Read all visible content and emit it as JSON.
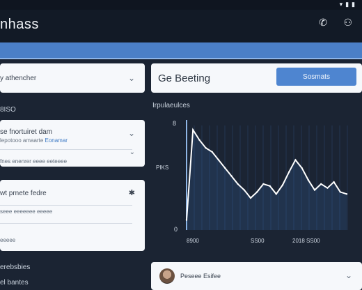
{
  "status_bar": {
    "icons": [
      "wifi-icon",
      "signal-icon",
      "battery-icon"
    ]
  },
  "app_bar": {
    "title": "nhass",
    "icons": [
      "phone-icon",
      "profile-icon"
    ]
  },
  "left_panel": {
    "dropdown_1": {
      "value": "y athencher"
    },
    "section_1_label": "8ISO",
    "card_2": {
      "header": "se fnortuiret dam",
      "subtext": "lepotooo amaarte",
      "subtext_link": "Eonamar",
      "row": "fnes enenrer eeee eeteeee"
    },
    "card_3": {
      "header": "wt prnete fedre",
      "row_1": "seee eeeeeee eeeee",
      "row_2": "eeeee"
    },
    "section_2_label": "erebsbies",
    "section_3_label": "el bantes"
  },
  "right_panel": {
    "search_value": "Ge Beeting",
    "button_label": "Sosmats",
    "chart_label": "Irpulaeulces",
    "bottom_card": {
      "name": "Peseee Esifee"
    }
  },
  "chart_data": {
    "type": "line",
    "title": "",
    "xlabel": "",
    "ylabel": "",
    "y_tick_labels": [
      "8",
      "0"
    ],
    "y_axis_label": "PIKS",
    "x_tick_labels": [
      "8900",
      "SS00",
      "2018 SS00"
    ],
    "x": [
      0,
      1,
      2,
      3,
      4,
      5,
      6,
      7,
      8,
      9,
      10,
      11,
      12,
      13,
      14,
      15,
      16,
      17,
      18,
      19,
      20,
      21,
      22,
      23,
      24,
      25
    ],
    "series": [
      {
        "values": [
          10,
          100,
          90,
          82,
          78,
          70,
          62,
          54,
          46,
          40,
          32,
          38,
          46,
          44,
          36,
          45,
          58,
          70,
          62,
          50,
          40,
          46,
          42,
          48,
          38,
          36
        ],
        "color": "#ffffff"
      }
    ],
    "ylim": [
      0,
      110
    ],
    "grid": false,
    "color_accent": "#3d7ac5"
  }
}
